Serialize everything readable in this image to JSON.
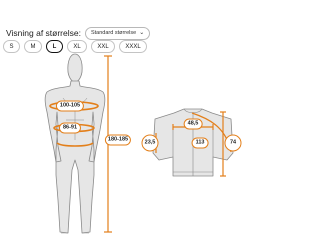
{
  "header": {
    "label": "Visning af størrelse:",
    "unit_select": "Standard størrelse"
  },
  "sizes": [
    {
      "label": "S",
      "selected": false
    },
    {
      "label": "M",
      "selected": false
    },
    {
      "label": "L",
      "selected": true
    },
    {
      "label": "XL",
      "selected": false
    },
    {
      "label": "XXL",
      "selected": false
    },
    {
      "label": "XXXL",
      "selected": false
    }
  ],
  "body": {
    "chest": "100-105",
    "waist": "86-91",
    "height": "180-185"
  },
  "garment": {
    "chest_width": "48,5",
    "sleeve_opening": "23,5",
    "sleeve_length": "113",
    "body_length": "74"
  },
  "colors": {
    "accent": "#e37f1a",
    "outline": "#8a8a8a",
    "shading": "#e6e6e6"
  }
}
